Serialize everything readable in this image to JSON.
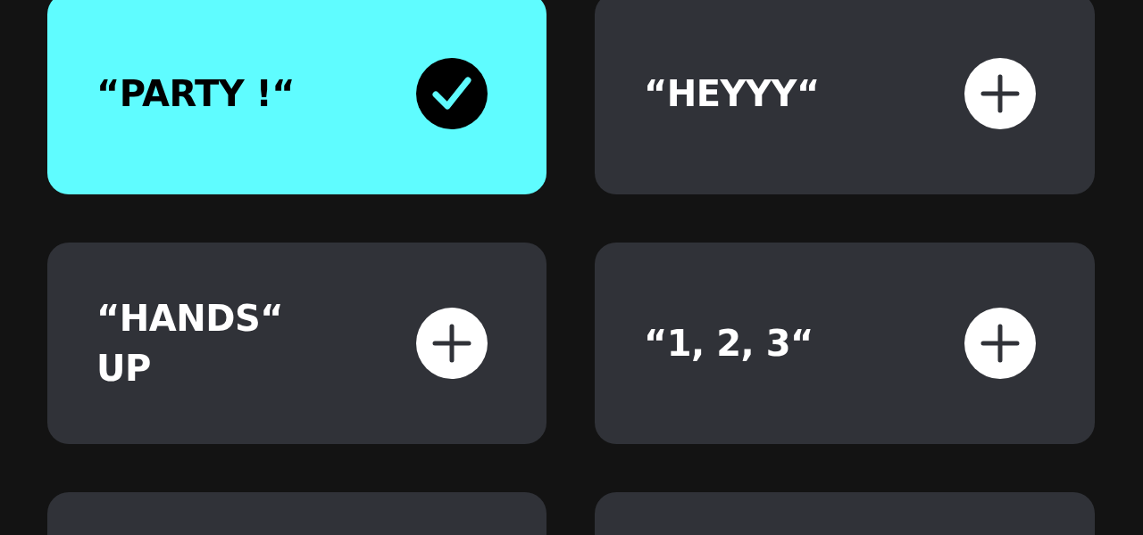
{
  "options": [
    {
      "label": "“PARTY !“",
      "selected": true
    },
    {
      "label": "“HEYYY“",
      "selected": false
    },
    {
      "label": "“HANDS“ UP",
      "selected": false
    },
    {
      "label": "“1, 2, 3“",
      "selected": false
    },
    {
      "selected": false
    },
    {
      "selected": false
    }
  ]
}
